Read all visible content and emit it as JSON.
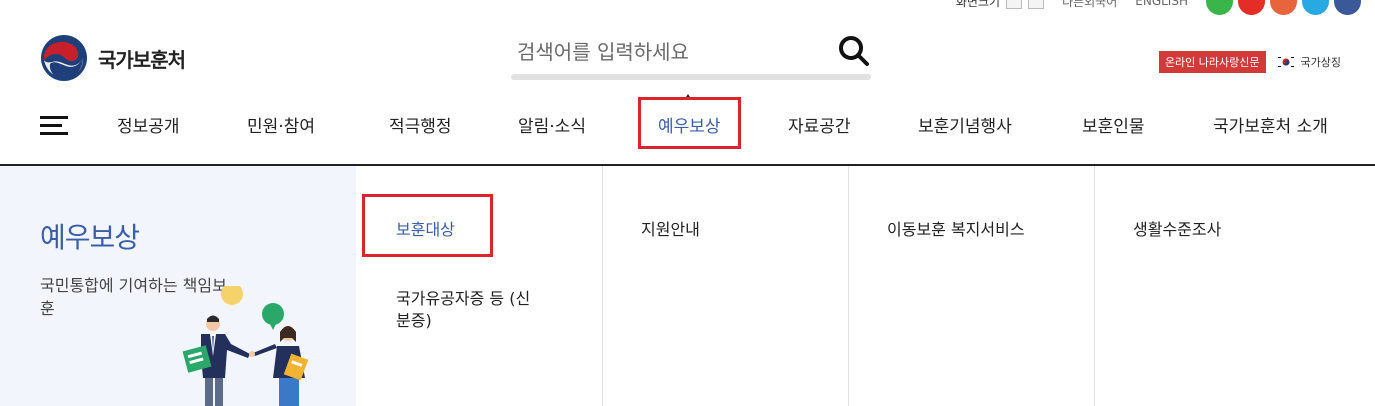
{
  "utility": {
    "zoom_label": "화면크기",
    "links": [
      "다른외국어",
      "ENGLISH"
    ],
    "social": [
      {
        "icon": "kakaotalk-icon",
        "color": "#39b54a"
      },
      {
        "icon": "youtube-icon",
        "color": "#e52d27"
      },
      {
        "icon": "instagram-icon",
        "color": "#e8643c"
      },
      {
        "icon": "twitter-icon",
        "color": "#29a9e1"
      },
      {
        "icon": "facebook-icon",
        "color": "#3b5998"
      }
    ]
  },
  "header": {
    "logo_text": "국가보훈처",
    "search_placeholder": "검색어를 입력하세요",
    "online_badge": "온라인 나라사랑신문",
    "symbol_label": "국가상징"
  },
  "nav": {
    "items": [
      "정보공개",
      "민원·참여",
      "적극행정",
      "알림·소식",
      "예우보상",
      "자료공간",
      "보훈기념행사",
      "보훈인물",
      "국가보훈처 소개"
    ],
    "active": "예우보상"
  },
  "mega": {
    "title": "예우보상",
    "desc": "국민통합에 기여하는 책임보훈",
    "columns": [
      [
        "보훈대상",
        "국가유공자증 등 (신분증)"
      ],
      [
        "지원안내"
      ],
      [
        "이동보훈 복지서비스"
      ],
      [
        "생활수준조사"
      ]
    ]
  },
  "colors": {
    "accent": "#3a5fa8",
    "highlight": "#d9252b",
    "badge": "#d23a3a",
    "panel_bg": "#f2f5fb"
  }
}
